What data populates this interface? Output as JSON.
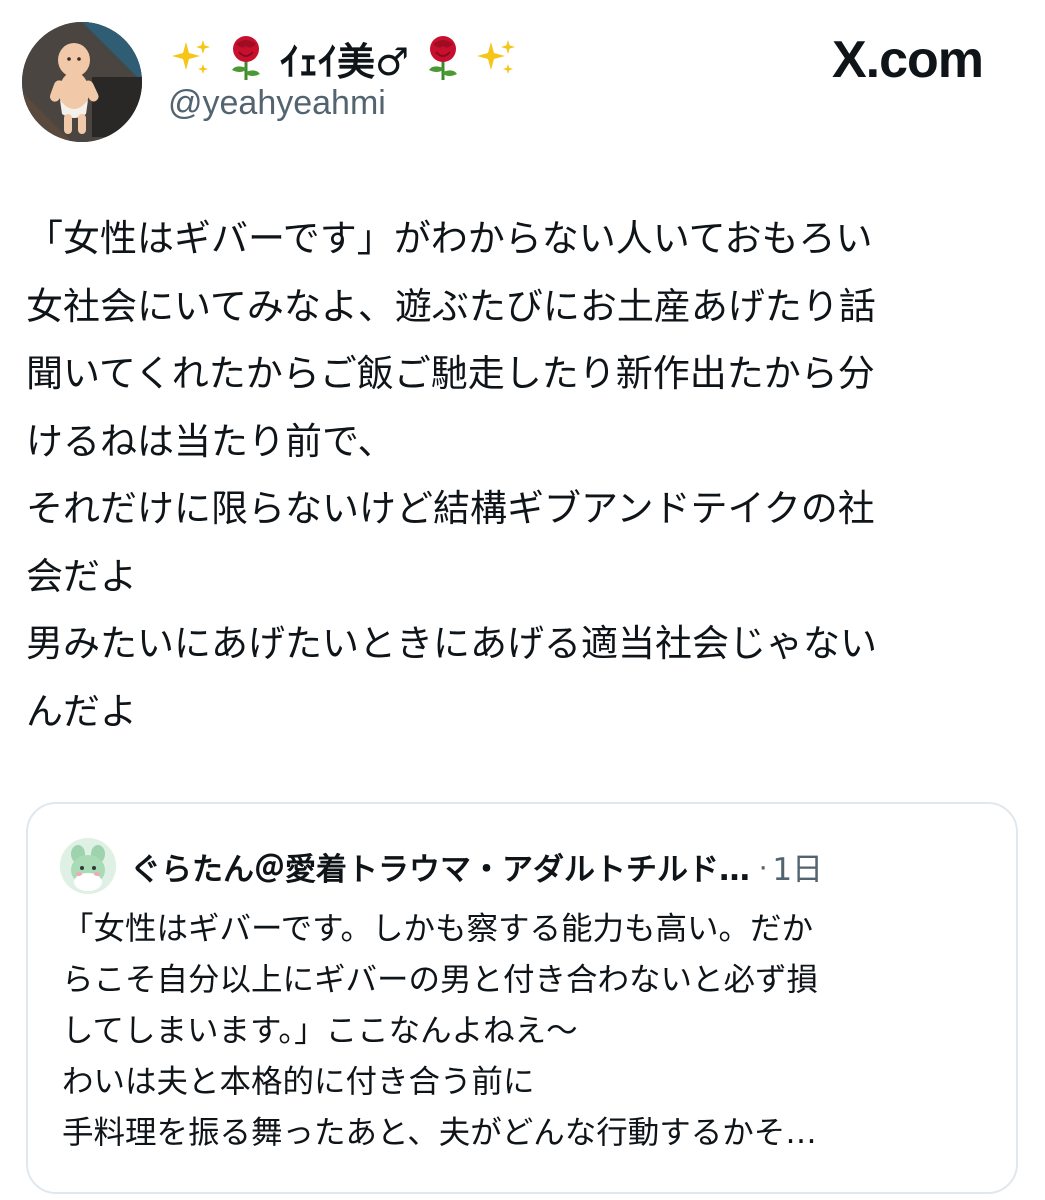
{
  "site": {
    "brand": "X.com",
    "logo_icon": "x-logo-icon"
  },
  "author": {
    "display_name": "ｲｪｲ美♂",
    "display_name_decorations": [
      "sparkles",
      "rose",
      "rose",
      "sparkles"
    ],
    "handle": "@yeahyeahmi"
  },
  "tweet": {
    "lines": [
      "「女性はギバーです」がわからない人いておもろい",
      "女社会にいてみなよ、遊ぶたびにお土産あげたり話",
      "聞いてくれたからご飯ご馳走したり新作出たから分",
      "けるねは当たり前で、",
      "それだけに限らないけど結構ギブアンドテイクの社",
      "会だよ",
      "男みたいにあげたいときにあげる適当社会じゃない",
      "んだよ"
    ]
  },
  "quoted_tweet": {
    "author": "ぐらたん＠愛着トラウマ・アダルトチルド…",
    "separator": "·",
    "time": "1日",
    "lines": [
      "「女性はギバーです。しかも察する能力も高い。だか",
      "らこそ自分以上にギバーの男と付き合わないと必ず損",
      "してしまいます。」ここなんよねえ〜",
      "わいは夫と本格的に付き合う前に",
      "手料理を振る舞ったあと、夫がどんな行動するかそ…"
    ]
  },
  "colors": {
    "text_primary": "#0f1419",
    "text_secondary": "#536471",
    "card_border": "#e1e8ed",
    "rose_red": "#c8102e",
    "sparkle_gold": "#f5c518"
  }
}
